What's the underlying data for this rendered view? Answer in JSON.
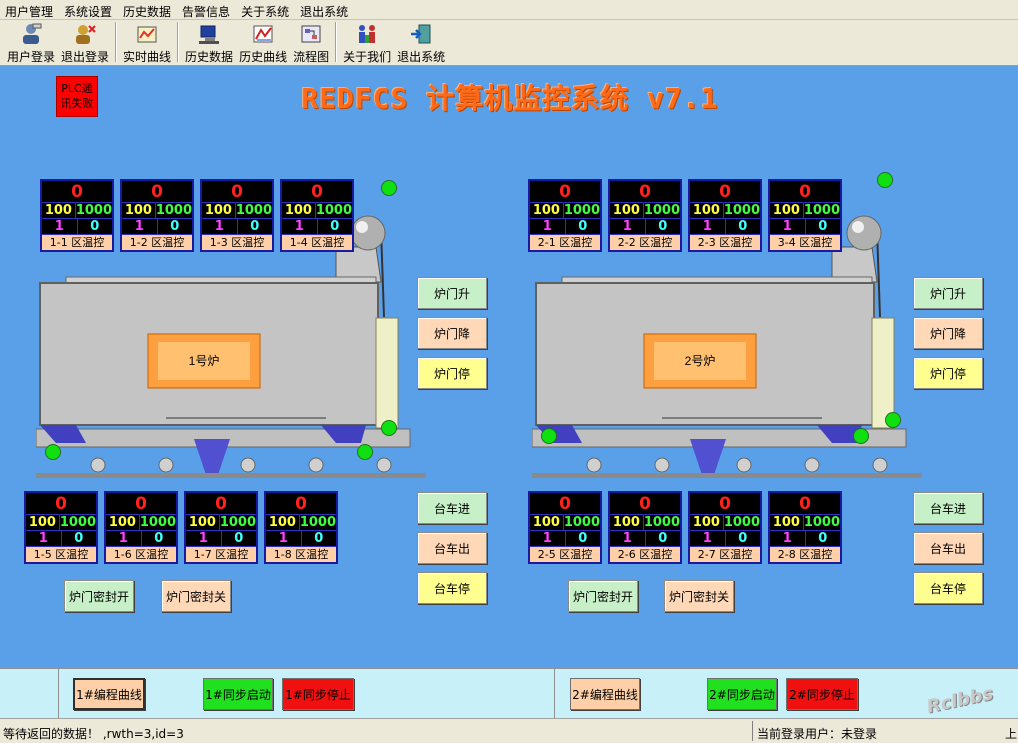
{
  "menu": [
    "用户管理",
    "系统设置",
    "历史数据",
    "告警信息",
    "关于系统",
    "退出系统"
  ],
  "toolbar": [
    {
      "label": "用户登录",
      "icon": "user-login-icon"
    },
    {
      "label": "退出登录",
      "icon": "logout-icon"
    },
    {
      "label": "实时曲线",
      "icon": "realtime-curve-icon"
    },
    {
      "label": "历史数据",
      "icon": "history-data-icon"
    },
    {
      "label": "历史曲线",
      "icon": "history-curve-icon"
    },
    {
      "label": "流程图",
      "icon": "flowchart-icon"
    },
    {
      "label": "关于我们",
      "icon": "about-icon"
    },
    {
      "label": "退出系统",
      "icon": "exit-icon"
    }
  ],
  "plc_status": "PLC通讯失败",
  "title": "REDFCS 计算机监控系统 v7.1",
  "furnaces": [
    {
      "name": "1号炉",
      "top_panels": [
        {
          "value": "0",
          "a": "100",
          "b": "1000",
          "c": "1",
          "d": "0",
          "name": "1-1 区温控"
        },
        {
          "value": "0",
          "a": "100",
          "b": "1000",
          "c": "1",
          "d": "0",
          "name": "1-2 区温控"
        },
        {
          "value": "0",
          "a": "100",
          "b": "1000",
          "c": "1",
          "d": "0",
          "name": "1-3 区温控"
        },
        {
          "value": "0",
          "a": "100",
          "b": "1000",
          "c": "1",
          "d": "0",
          "name": "1-4 区温控"
        }
      ],
      "bottom_panels": [
        {
          "value": "0",
          "a": "100",
          "b": "1000",
          "c": "1",
          "d": "0",
          "name": "1-5 区温控"
        },
        {
          "value": "0",
          "a": "100",
          "b": "1000",
          "c": "1",
          "d": "0",
          "name": "1-6 区温控"
        },
        {
          "value": "0",
          "a": "100",
          "b": "1000",
          "c": "1",
          "d": "0",
          "name": "1-7 区温控"
        },
        {
          "value": "0",
          "a": "100",
          "b": "1000",
          "c": "1",
          "d": "0",
          "name": "1-8 区温控"
        }
      ],
      "door_buttons": [
        "炉门升",
        "炉门降",
        "炉门停"
      ],
      "cart_buttons": [
        "台车进",
        "台车出",
        "台车停"
      ],
      "seal_buttons": [
        "炉门密封开",
        "炉门密封关"
      ]
    },
    {
      "name": "2号炉",
      "top_panels": [
        {
          "value": "0",
          "a": "100",
          "b": "1000",
          "c": "1",
          "d": "0",
          "name": "2-1 区温控"
        },
        {
          "value": "0",
          "a": "100",
          "b": "1000",
          "c": "1",
          "d": "0",
          "name": "2-2 区温控"
        },
        {
          "value": "0",
          "a": "100",
          "b": "1000",
          "c": "1",
          "d": "0",
          "name": "2-3 区温控"
        },
        {
          "value": "0",
          "a": "100",
          "b": "1000",
          "c": "1",
          "d": "0",
          "name": "3-4 区温控"
        }
      ],
      "bottom_panels": [
        {
          "value": "0",
          "a": "100",
          "b": "1000",
          "c": "1",
          "d": "0",
          "name": "2-5 区温控"
        },
        {
          "value": "0",
          "a": "100",
          "b": "1000",
          "c": "1",
          "d": "0",
          "name": "2-6 区温控"
        },
        {
          "value": "0",
          "a": "100",
          "b": "1000",
          "c": "1",
          "d": "0",
          "name": "2-7 区温控"
        },
        {
          "value": "0",
          "a": "100",
          "b": "1000",
          "c": "1",
          "d": "0",
          "name": "2-8 区温控"
        }
      ],
      "door_buttons": [
        "炉门升",
        "炉门降",
        "炉门停"
      ],
      "cart_buttons": [
        "台车进",
        "台车出",
        "台车停"
      ],
      "seal_buttons": [
        "炉门密封开",
        "炉门密封关"
      ]
    }
  ],
  "bottom_bar": {
    "f1_curve": "1#编程曲线",
    "f1_start": "1#同步启动",
    "f1_stop": "1#同步停止",
    "f2_curve": "2#编程曲线",
    "f2_start": "2#同步启动",
    "f2_stop": "2#同步停止"
  },
  "status_bar": {
    "left": "等待返回的数据！ ,rwth=3,id=3",
    "user": "当前登录用户：未登录",
    "right": "上"
  },
  "watermark": "Rclbbs",
  "colors": {
    "background": "#5aa0e8",
    "title": "#ff6a1a",
    "indicator": "#10e010",
    "alarm": "#ff0000"
  }
}
